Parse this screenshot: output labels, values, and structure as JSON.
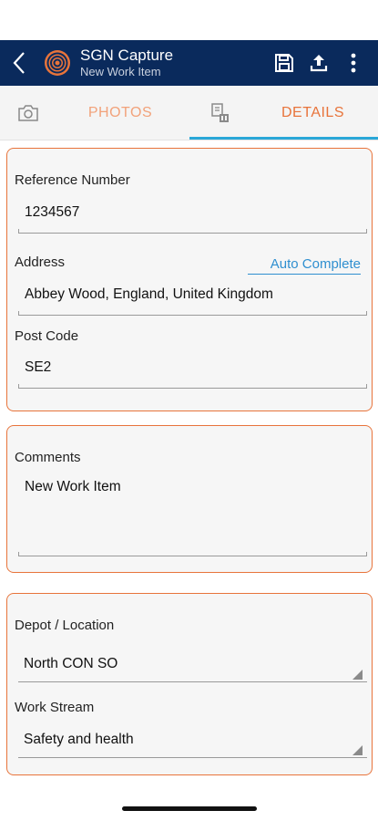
{
  "appbar": {
    "title": "SGN Capture",
    "subtitle": "New Work Item",
    "background": "#0a2a5c"
  },
  "icons": {
    "back": "chevron-left-icon",
    "logo": "sgn-logo-icon",
    "save": "save-icon",
    "upload": "upload-icon",
    "menu": "more-vert-icon",
    "camera": "camera-icon",
    "details": "document-edit-icon"
  },
  "tabs": [
    {
      "label": "PHOTOS",
      "active": false
    },
    {
      "label": "DETAILS",
      "active": true
    }
  ],
  "colors": {
    "accent": "#e8743b",
    "tab_indicator": "#2aa7d8",
    "link": "#2f8fd0"
  },
  "details": {
    "reference_number": {
      "label": "Reference Number",
      "value": "1234567"
    },
    "address": {
      "label": "Address",
      "value": "Abbey Wood, England, United Kingdom",
      "auto_complete": "Auto Complete"
    },
    "post_code": {
      "label": "Post Code",
      "value": "SE2"
    },
    "comments": {
      "label": "Comments",
      "value": "New Work Item"
    },
    "depot_location": {
      "label": "Depot / Location",
      "value": "North CON SO"
    },
    "work_stream": {
      "label": "Work Stream",
      "value": "Safety and health"
    }
  }
}
